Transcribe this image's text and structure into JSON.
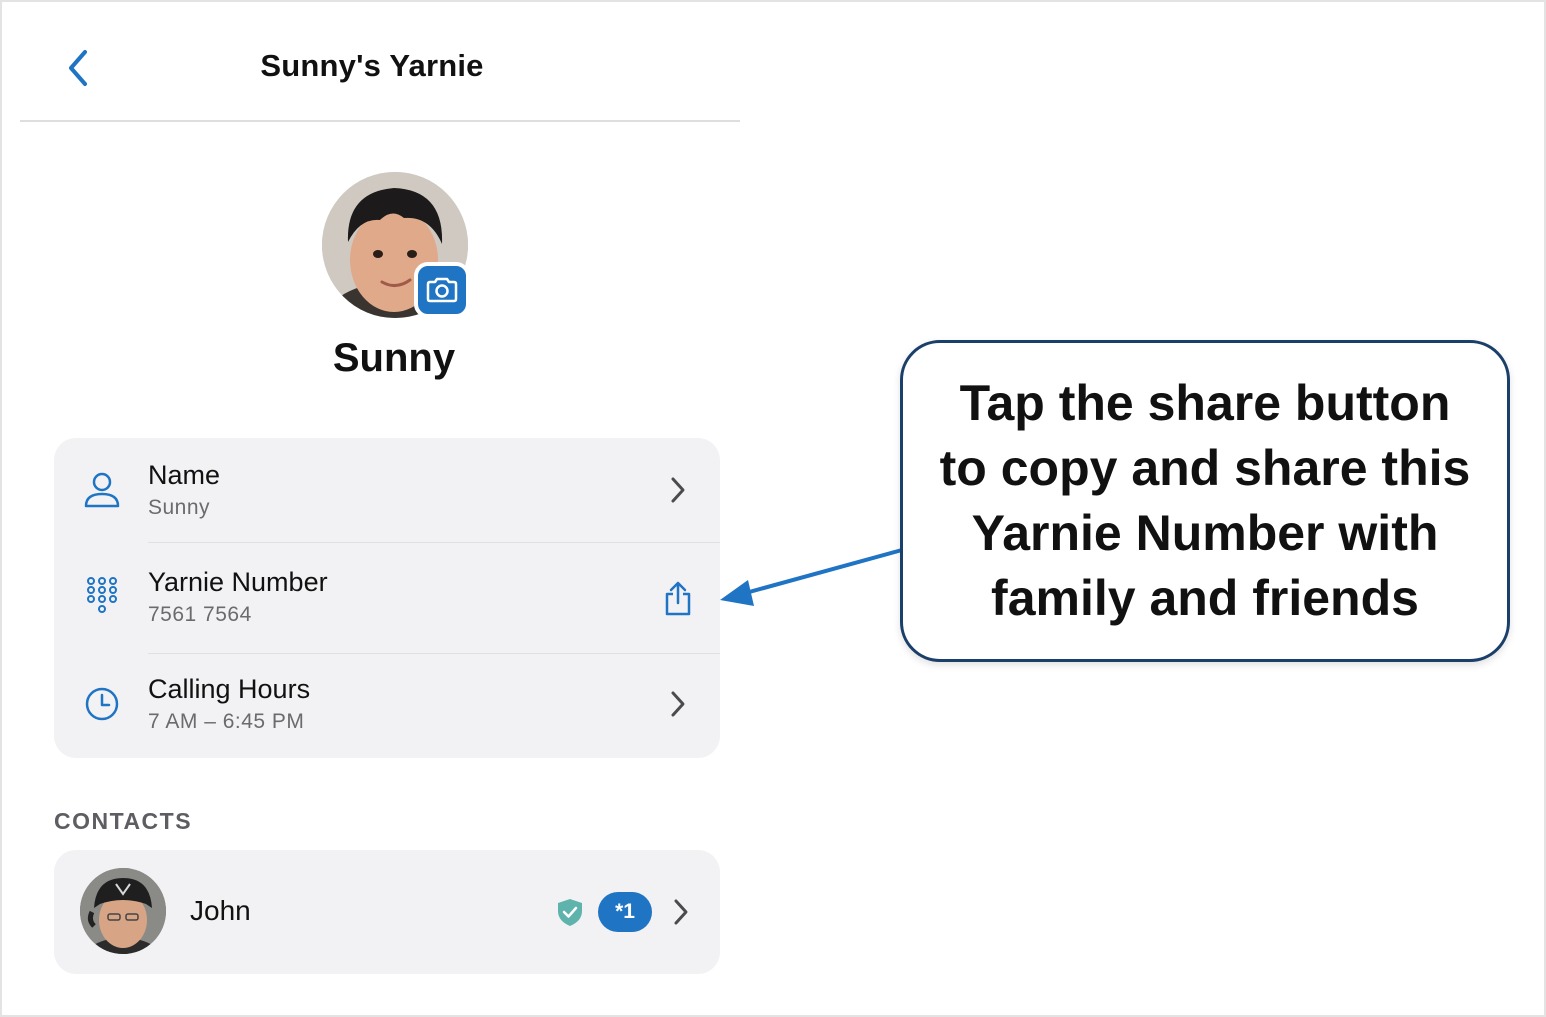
{
  "header": {
    "title": "Sunny's Yarnie",
    "back_icon": "chevron-left-icon"
  },
  "profile": {
    "name": "Sunny",
    "camera_icon": "camera-icon"
  },
  "details": [
    {
      "title": "Name",
      "value": "Sunny",
      "icon": "person-icon",
      "action_icon": "chevron-right-icon"
    },
    {
      "title": "Yarnie Number",
      "value": "7561 7564",
      "icon": "keypad-icon",
      "action_icon": "share-icon"
    },
    {
      "title": "Calling Hours",
      "value": "7 AM – 6:45 PM",
      "icon": "clock-icon",
      "action_icon": "chevron-right-icon"
    }
  ],
  "contacts": {
    "section_label": "CONTACTS",
    "items": [
      {
        "name": "John",
        "badge": "*1",
        "verified_icon": "shield-check-icon"
      }
    ]
  },
  "callout": {
    "text": "Tap the share button to copy and share this Yarnie Number with family and friends"
  },
  "colors": {
    "accent": "#1f74c3",
    "card_bg": "#f2f2f4",
    "callout_border": "#1b3f6b",
    "verified": "#5fb3ad"
  }
}
